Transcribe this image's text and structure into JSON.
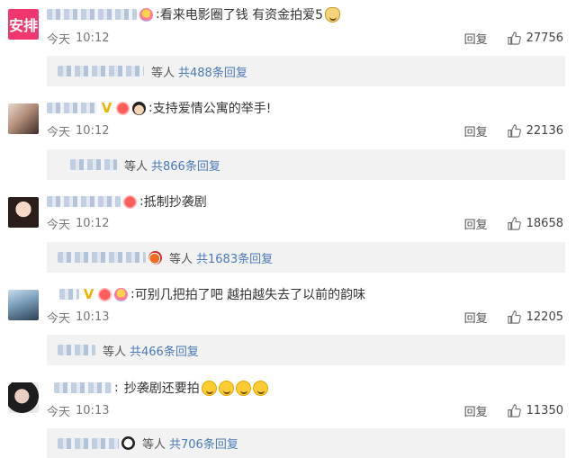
{
  "comments": [
    {
      "avatar_text": "安排",
      "badges": [
        "lightbulb-badge-icon"
      ],
      "text": "看来电影圈了钱 有资金拍爱5",
      "emoji": [
        "dog-emoji"
      ],
      "time_day": "今天",
      "time": "10:12",
      "reply_label": "回复",
      "likes": "27756",
      "reply_etc": "等人",
      "reply_total": "共488条回复"
    },
    {
      "badges": [
        "vip-v-badge-icon",
        "heart-badge-icon",
        "face-badge-icon"
      ],
      "text": "支持爱情公寓的举手!",
      "emoji": [],
      "time_day": "今天",
      "time": "10:12",
      "reply_label": "回复",
      "likes": "22136",
      "reply_etc": "等人",
      "reply_total": "共866条回复"
    },
    {
      "badges": [
        "heart-badge-icon"
      ],
      "text": "抵制抄袭剧",
      "emoji": [],
      "time_day": "今天",
      "time": "10:12",
      "reply_label": "回复",
      "likes": "18658",
      "reply_etc": "等人",
      "reply_total": "共1683条回复"
    },
    {
      "badges": [
        "vip-v-badge-icon",
        "heart-badge-icon",
        "lightbulb-badge-icon"
      ],
      "text": "可别几把拍了吧 越拍越失去了以前的韵味",
      "emoji": [],
      "time_day": "今天",
      "time": "10:13",
      "reply_label": "回复",
      "likes": "12205",
      "reply_etc": "等人",
      "reply_total": "共466条回复"
    },
    {
      "badges": [],
      "text": "抄袭剧还要拍",
      "emoji": [
        "sweat-smile-emoji",
        "sweat-smile-emoji",
        "sweat-smile-emoji",
        "sweat-smile-emoji"
      ],
      "time_day": "今天",
      "time": "10:13",
      "reply_label": "回复",
      "likes": "11350",
      "reply_etc": "等人",
      "reply_total": "共706条回复"
    }
  ],
  "colors": {
    "link": "#4b7ab8",
    "brand_avatar": "#f0366e",
    "reply_bg": "#f2f2f2"
  }
}
